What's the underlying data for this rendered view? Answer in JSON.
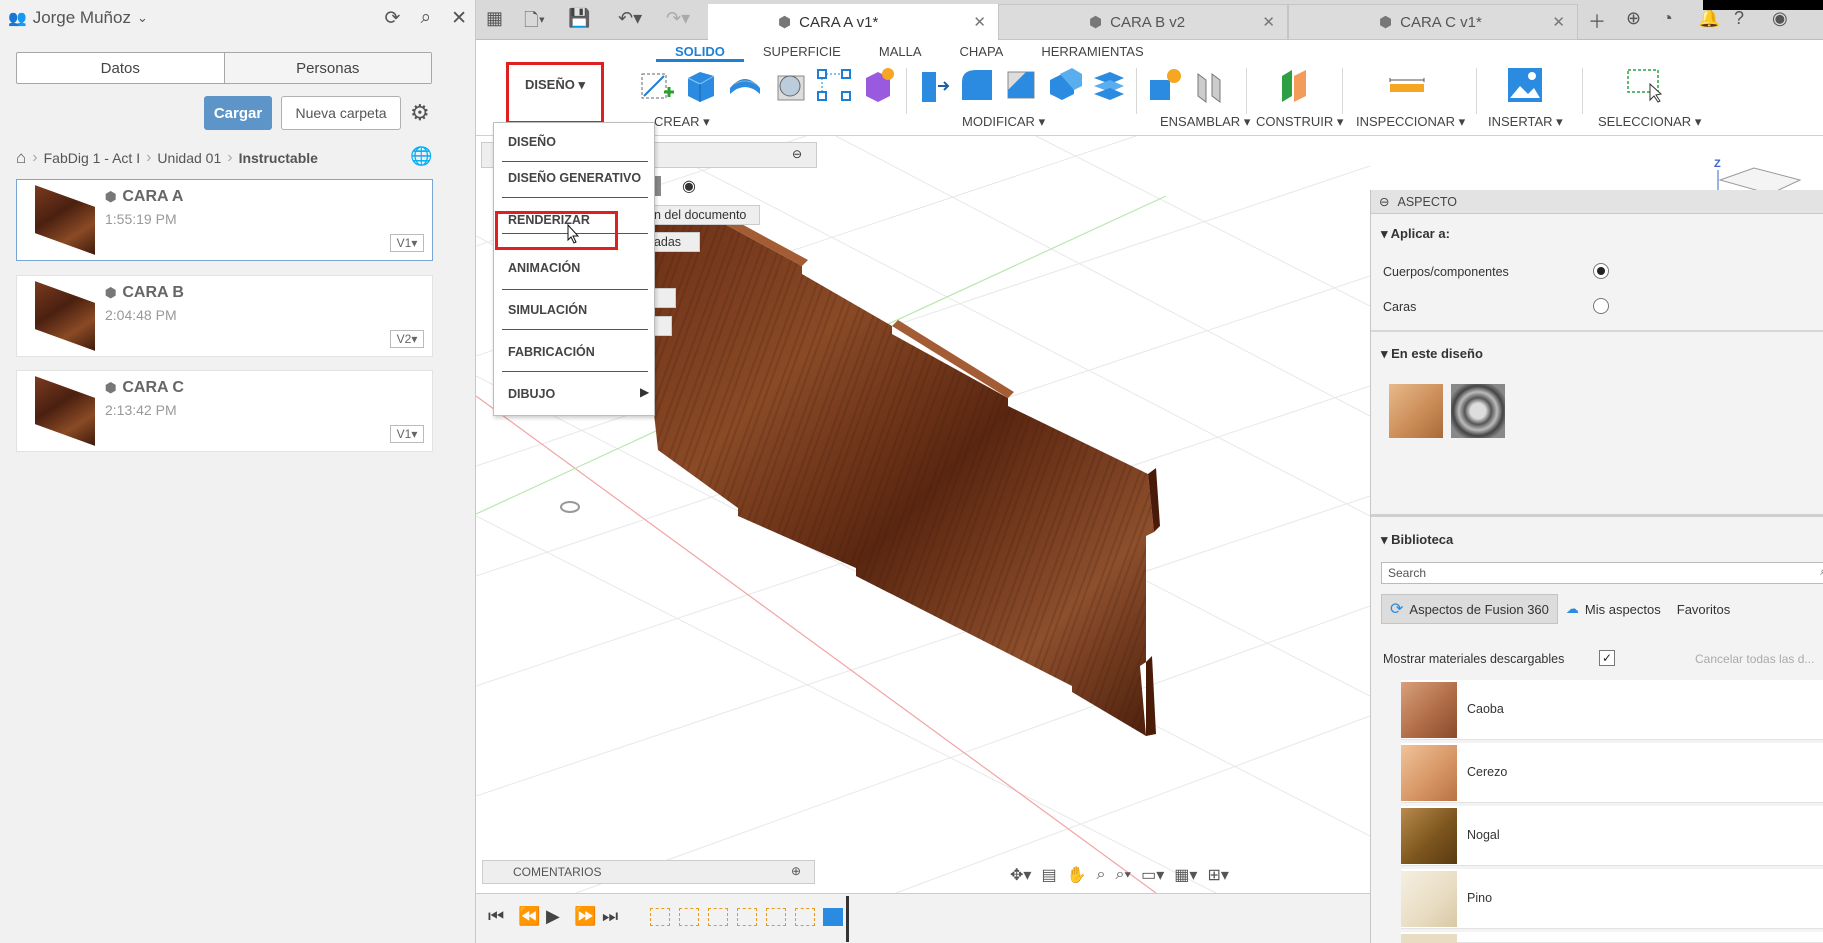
{
  "left_panel": {
    "user_name": "Jorge Muñoz",
    "tabs": [
      "Datos",
      "Personas"
    ],
    "upload_label": "Cargar",
    "new_folder_label": "Nueva carpeta",
    "breadcrumb": [
      "FabDig 1 - Act I",
      "Unidad 01",
      "Instructable"
    ],
    "files": [
      {
        "name": "CARA A",
        "time": "1:55:19 PM",
        "version": "V1"
      },
      {
        "name": "CARA B",
        "time": "2:04:48 PM",
        "version": "V2"
      },
      {
        "name": "CARA C",
        "time": "2:13:42 PM",
        "version": "V1"
      }
    ]
  },
  "doc_tabs": [
    {
      "label": "CARA A v1*",
      "active": true
    },
    {
      "label": "CARA B v2",
      "active": false
    },
    {
      "label": "CARA C v1*",
      "active": false
    }
  ],
  "ribbon": {
    "workspace": "DISEÑO",
    "tabs": [
      "SOLIDO",
      "SUPERFICIE",
      "MALLA",
      "CHAPA",
      "HERRAMIENTAS"
    ],
    "groups": [
      "CREAR",
      "MODIFICAR",
      "ENSAMBLAR",
      "CONSTRUIR",
      "INSPECCIONAR",
      "INSERTAR",
      "SELECCIONAR"
    ]
  },
  "workspace_menu": [
    "DISEÑO",
    "DISEÑO GENERATIVO",
    "RENDERIZAR",
    "ANIMACIÓN",
    "SIMULACIÓN",
    "FABRICACIÓN",
    "DIBUJO"
  ],
  "browser_fragments": [
    "1",
    "on del documento",
    "dadas",
    "s",
    "s"
  ],
  "comments_label": "COMENTARIOS",
  "viewcube_axis": "Z",
  "appearance": {
    "title": "ASPECTO",
    "apply_to": {
      "heading": "Aplicar a:",
      "options": [
        "Cuerpos/componentes",
        "Caras"
      ]
    },
    "in_design_heading": "En este diseño",
    "library_heading": "Biblioteca",
    "search_placeholder": "Search",
    "library_tabs": [
      "Aspectos de Fusion 360",
      "Mis aspectos",
      "Favoritos"
    ],
    "show_downloadable": "Mostrar materiales descargables",
    "cancel_all": "Cancelar todas las d...",
    "materials": [
      "Caoba",
      "Cerezo",
      "Nogal",
      "Pino"
    ]
  }
}
